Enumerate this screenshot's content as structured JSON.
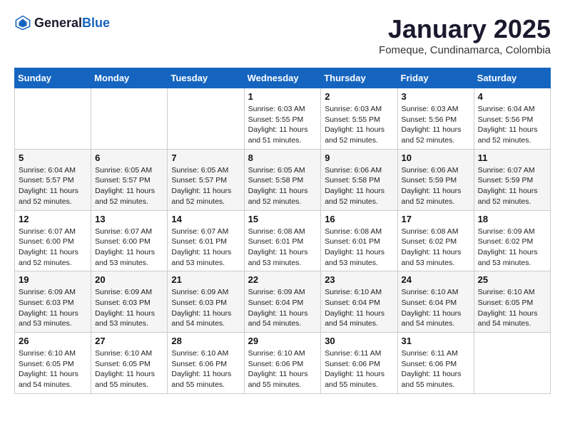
{
  "logo": {
    "general": "General",
    "blue": "Blue"
  },
  "title": "January 2025",
  "location": "Fomeque, Cundinamarca, Colombia",
  "weekdays": [
    "Sunday",
    "Monday",
    "Tuesday",
    "Wednesday",
    "Thursday",
    "Friday",
    "Saturday"
  ],
  "weeks": [
    [
      {
        "day": "",
        "sunrise": "",
        "sunset": "",
        "daylight": ""
      },
      {
        "day": "",
        "sunrise": "",
        "sunset": "",
        "daylight": ""
      },
      {
        "day": "",
        "sunrise": "",
        "sunset": "",
        "daylight": ""
      },
      {
        "day": "1",
        "sunrise": "Sunrise: 6:03 AM",
        "sunset": "Sunset: 5:55 PM",
        "daylight": "Daylight: 11 hours and 51 minutes."
      },
      {
        "day": "2",
        "sunrise": "Sunrise: 6:03 AM",
        "sunset": "Sunset: 5:55 PM",
        "daylight": "Daylight: 11 hours and 52 minutes."
      },
      {
        "day": "3",
        "sunrise": "Sunrise: 6:03 AM",
        "sunset": "Sunset: 5:56 PM",
        "daylight": "Daylight: 11 hours and 52 minutes."
      },
      {
        "day": "4",
        "sunrise": "Sunrise: 6:04 AM",
        "sunset": "Sunset: 5:56 PM",
        "daylight": "Daylight: 11 hours and 52 minutes."
      }
    ],
    [
      {
        "day": "5",
        "sunrise": "Sunrise: 6:04 AM",
        "sunset": "Sunset: 5:57 PM",
        "daylight": "Daylight: 11 hours and 52 minutes."
      },
      {
        "day": "6",
        "sunrise": "Sunrise: 6:05 AM",
        "sunset": "Sunset: 5:57 PM",
        "daylight": "Daylight: 11 hours and 52 minutes."
      },
      {
        "day": "7",
        "sunrise": "Sunrise: 6:05 AM",
        "sunset": "Sunset: 5:57 PM",
        "daylight": "Daylight: 11 hours and 52 minutes."
      },
      {
        "day": "8",
        "sunrise": "Sunrise: 6:05 AM",
        "sunset": "Sunset: 5:58 PM",
        "daylight": "Daylight: 11 hours and 52 minutes."
      },
      {
        "day": "9",
        "sunrise": "Sunrise: 6:06 AM",
        "sunset": "Sunset: 5:58 PM",
        "daylight": "Daylight: 11 hours and 52 minutes."
      },
      {
        "day": "10",
        "sunrise": "Sunrise: 6:06 AM",
        "sunset": "Sunset: 5:59 PM",
        "daylight": "Daylight: 11 hours and 52 minutes."
      },
      {
        "day": "11",
        "sunrise": "Sunrise: 6:07 AM",
        "sunset": "Sunset: 5:59 PM",
        "daylight": "Daylight: 11 hours and 52 minutes."
      }
    ],
    [
      {
        "day": "12",
        "sunrise": "Sunrise: 6:07 AM",
        "sunset": "Sunset: 6:00 PM",
        "daylight": "Daylight: 11 hours and 52 minutes."
      },
      {
        "day": "13",
        "sunrise": "Sunrise: 6:07 AM",
        "sunset": "Sunset: 6:00 PM",
        "daylight": "Daylight: 11 hours and 53 minutes."
      },
      {
        "day": "14",
        "sunrise": "Sunrise: 6:07 AM",
        "sunset": "Sunset: 6:01 PM",
        "daylight": "Daylight: 11 hours and 53 minutes."
      },
      {
        "day": "15",
        "sunrise": "Sunrise: 6:08 AM",
        "sunset": "Sunset: 6:01 PM",
        "daylight": "Daylight: 11 hours and 53 minutes."
      },
      {
        "day": "16",
        "sunrise": "Sunrise: 6:08 AM",
        "sunset": "Sunset: 6:01 PM",
        "daylight": "Daylight: 11 hours and 53 minutes."
      },
      {
        "day": "17",
        "sunrise": "Sunrise: 6:08 AM",
        "sunset": "Sunset: 6:02 PM",
        "daylight": "Daylight: 11 hours and 53 minutes."
      },
      {
        "day": "18",
        "sunrise": "Sunrise: 6:09 AM",
        "sunset": "Sunset: 6:02 PM",
        "daylight": "Daylight: 11 hours and 53 minutes."
      }
    ],
    [
      {
        "day": "19",
        "sunrise": "Sunrise: 6:09 AM",
        "sunset": "Sunset: 6:03 PM",
        "daylight": "Daylight: 11 hours and 53 minutes."
      },
      {
        "day": "20",
        "sunrise": "Sunrise: 6:09 AM",
        "sunset": "Sunset: 6:03 PM",
        "daylight": "Daylight: 11 hours and 53 minutes."
      },
      {
        "day": "21",
        "sunrise": "Sunrise: 6:09 AM",
        "sunset": "Sunset: 6:03 PM",
        "daylight": "Daylight: 11 hours and 54 minutes."
      },
      {
        "day": "22",
        "sunrise": "Sunrise: 6:09 AM",
        "sunset": "Sunset: 6:04 PM",
        "daylight": "Daylight: 11 hours and 54 minutes."
      },
      {
        "day": "23",
        "sunrise": "Sunrise: 6:10 AM",
        "sunset": "Sunset: 6:04 PM",
        "daylight": "Daylight: 11 hours and 54 minutes."
      },
      {
        "day": "24",
        "sunrise": "Sunrise: 6:10 AM",
        "sunset": "Sunset: 6:04 PM",
        "daylight": "Daylight: 11 hours and 54 minutes."
      },
      {
        "day": "25",
        "sunrise": "Sunrise: 6:10 AM",
        "sunset": "Sunset: 6:05 PM",
        "daylight": "Daylight: 11 hours and 54 minutes."
      }
    ],
    [
      {
        "day": "26",
        "sunrise": "Sunrise: 6:10 AM",
        "sunset": "Sunset: 6:05 PM",
        "daylight": "Daylight: 11 hours and 54 minutes."
      },
      {
        "day": "27",
        "sunrise": "Sunrise: 6:10 AM",
        "sunset": "Sunset: 6:05 PM",
        "daylight": "Daylight: 11 hours and 55 minutes."
      },
      {
        "day": "28",
        "sunrise": "Sunrise: 6:10 AM",
        "sunset": "Sunset: 6:06 PM",
        "daylight": "Daylight: 11 hours and 55 minutes."
      },
      {
        "day": "29",
        "sunrise": "Sunrise: 6:10 AM",
        "sunset": "Sunset: 6:06 PM",
        "daylight": "Daylight: 11 hours and 55 minutes."
      },
      {
        "day": "30",
        "sunrise": "Sunrise: 6:11 AM",
        "sunset": "Sunset: 6:06 PM",
        "daylight": "Daylight: 11 hours and 55 minutes."
      },
      {
        "day": "31",
        "sunrise": "Sunrise: 6:11 AM",
        "sunset": "Sunset: 6:06 PM",
        "daylight": "Daylight: 11 hours and 55 minutes."
      },
      {
        "day": "",
        "sunrise": "",
        "sunset": "",
        "daylight": ""
      }
    ]
  ]
}
